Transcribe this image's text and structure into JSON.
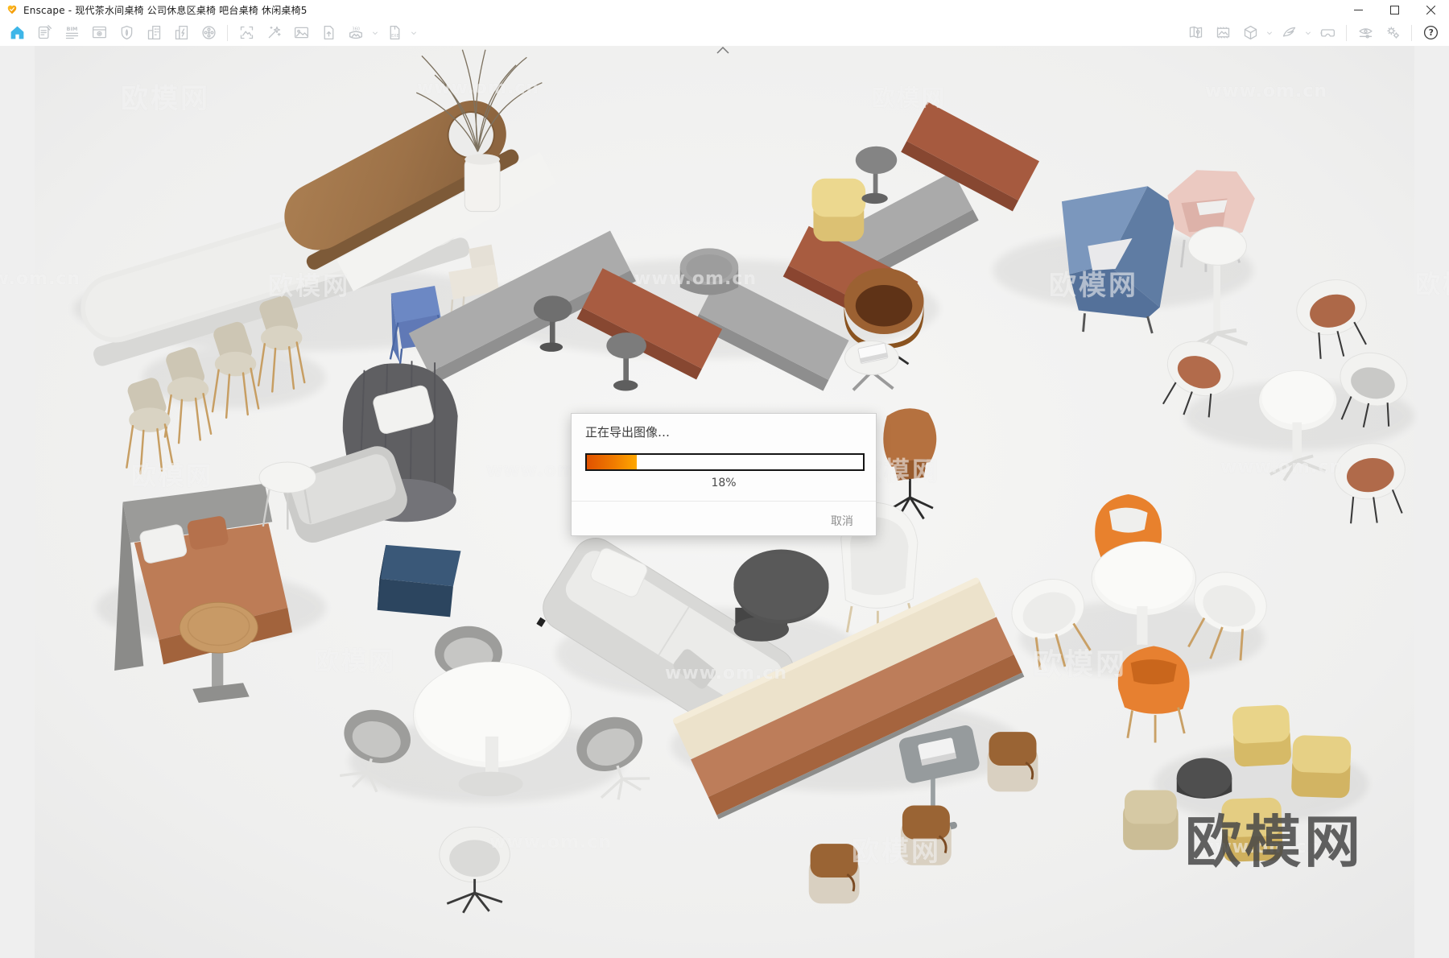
{
  "window": {
    "app_title": "Enscape - 现代茶水间桌椅 公司休息区桌椅 吧台桌椅 休闲桌椅5",
    "controls": {
      "minimize": "最小化",
      "maximize": "最大化",
      "close": "关闭"
    }
  },
  "toolbar": {
    "left_icons": [
      "home",
      "document-notes",
      "bim",
      "window-view",
      "shield-leaf",
      "building",
      "building-energy",
      "video-film",
      "screenshot",
      "magic-enhance",
      "render-image",
      "upload-file",
      "panorama-360",
      "export-exe"
    ],
    "right_icons": [
      "map-location",
      "textured-image",
      "orbit-cube",
      "wing-fly",
      "vr-headset",
      "visual-settings",
      "general-settings",
      "help"
    ],
    "bim_label": "BIM",
    "pano_label": "360",
    "exe_label": "EXE",
    "help_label": "?",
    "collapse_hint": "^"
  },
  "export_dialog": {
    "title": "正在导出图像…",
    "progress_percent": 18,
    "progress_text": "18%",
    "cancel_label": "取消"
  },
  "watermark": {
    "site_name": "欧模网",
    "site_url": "www.om.cn"
  },
  "colors": {
    "home_icon_blue": "#3eb6e8",
    "logo_orange": "#f5a21b",
    "progress_gradient_start": "#e05200",
    "progress_gradient_end": "#ffa800"
  }
}
